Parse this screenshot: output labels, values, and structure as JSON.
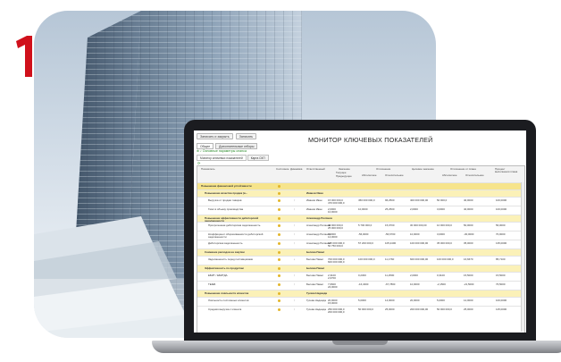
{
  "brand": {
    "logo_text": "1С",
    "registered_mark": "®",
    "red": "#d0101b"
  },
  "window": {
    "title": "МОНИТОР КЛЮЧЕВЫХ ПОКАЗАТЕЛЕЙ",
    "toolbar": [
      {
        "label": "Записать и закрыть"
      },
      {
        "label": "Записать"
      }
    ],
    "tabs": [
      {
        "label": "Общее"
      },
      {
        "label": "Дополнительные отборы"
      }
    ],
    "settings_link": "⊕ ♪ Основные параметры сеанса",
    "subtabs": [
      {
        "label": "Монитор ключевых показателей"
      },
      {
        "label": "Карта СКП"
      }
    ],
    "refresh_icon": "refresh-icon"
  },
  "table": {
    "headers": {
      "indicator": "Показатель",
      "status": "Состояние",
      "dynamics": "Динамика",
      "responsible": "Ответственный",
      "value": "Значение",
      "value_sub1": "Текущее",
      "value_sub2": "Предыдущее",
      "deviation": "Отклонение",
      "deviation_abs": "Абсолютное",
      "deviation_rel": "Относительное",
      "target": "Целевое значение",
      "target_dev": "Отклонение от плана",
      "target_dev_abs": "Абсолютное",
      "target_dev_rel": "Относительное",
      "fulfilment": "Процент выполнения плана"
    },
    "rows": [
      {
        "kind": "top",
        "name": "Повышение финансовой устойчивости",
        "status": "●",
        "dyn": "",
        "resp": "",
        "cur": "",
        "prev": "",
        "abs": "",
        "rel": "",
        "target": "",
        "tabs": "",
        "trel": "",
        "pct": "",
        "dot": "#e3b62a"
      },
      {
        "kind": "group",
        "name": "Повышение качества продаж (в...",
        "status": "●",
        "dyn": "",
        "resp": "Иванов Иван",
        "cur": "",
        "prev": "",
        "abs": "",
        "rel": "",
        "target": "",
        "tabs": "",
        "trel": "",
        "pct": "",
        "dot": "#e3b62a"
      },
      {
        "kind": "item",
        "name": "Выручка от продаж товаров",
        "status": "●",
        "dyn": "↑",
        "resp": "Иванов Иван",
        "cur": "15 000 000,0",
        "prev": "470 000 000,0",
        "abs": "450 000 000,0",
        "rel": "96,2500",
        "target": "400 000 000,00",
        "tabs": "50 000,0",
        "trel": "40,0000",
        "pct": "100,0000",
        "dot": "#e3b62a"
      },
      {
        "kind": "item",
        "name": "Темп в объему производства",
        "status": "●",
        "dyn": "↑",
        "resp": "Иванов Иван",
        "cur": "2,0000",
        "prev": "10,0000",
        "abs": "10,0000",
        "rel": "25,2500",
        "target": "2,0000",
        "tabs": "3,0000",
        "trel": "40,0000",
        "pct": "100,0000",
        "dot": "#e3b62a"
      },
      {
        "kind": "group",
        "name": "Повышение эффективности дебиторской задолженности",
        "status": "●",
        "dyn": "",
        "resp": "Александр Полянов",
        "cur": "",
        "prev": "",
        "abs": "",
        "rel": "",
        "target": "",
        "tabs": "",
        "trel": "",
        "pct": "",
        "dot": "#e3b62a"
      },
      {
        "kind": "item",
        "name": "Просроченная дебиторская задолженность",
        "status": "●",
        "dyn": "↑",
        "resp": "Александр Полянов",
        "cur": "40 000 000,0",
        "prev": "25 000 000,0",
        "abs": "5 700 000,0",
        "rel": "15,0700",
        "target": "30 000 000,00",
        "tabs": "10 000 000,0",
        "trel": "50,0000",
        "pct": "56,0000",
        "dot": "#e3b62a"
      },
      {
        "kind": "item",
        "name": "Коэффициент оборачиваемости дебиторской задолженности",
        "status": "●",
        "dyn": "↑",
        "resp": "Александр Полянов",
        "cur": "7,0000",
        "prev": "14,0000",
        "abs": "-56,0000",
        "rel": "-56,6700",
        "target": "10,0000",
        "tabs": "3,0000",
        "trel": "-30,0000",
        "pct": "70,0000",
        "dot": "#e3b62a"
      },
      {
        "kind": "item",
        "name": "Дебиторская задолженность",
        "status": "●",
        "dyn": "↑",
        "resp": "Александр Полянов",
        "cur": "135 000 000,0",
        "prev": "50 750 000,0",
        "abs": "57 200 000,0",
        "rel": "105,2400",
        "target": "100 000 000,00",
        "tabs": "35 000 000,0",
        "trel": "35,0000",
        "pct": "135,0000",
        "dot": "#e3b62a"
      },
      {
        "kind": "group",
        "name": "Снижение расходов на закупки",
        "status": "●",
        "dyn": "",
        "resp": "Белова Павел",
        "cur": "",
        "prev": "",
        "abs": "",
        "rel": "",
        "target": "",
        "tabs": "",
        "trel": "",
        "pct": "",
        "dot": "#e3b62a"
      },
      {
        "kind": "item",
        "name": "Задолженность перед поставщиками",
        "status": "●",
        "dyn": "↓",
        "resp": "Белова Павел",
        "cur": "700 000 000,0",
        "prev": "600 000 000,0",
        "abs": "100 000 000,0",
        "rel": "11,1760",
        "target": "600 000 000,00",
        "tabs": "100 000 000,0",
        "trel": "16,6670",
        "pct": "85,7100",
        "dot": "#e3b62a"
      },
      {
        "kind": "group",
        "name": "Эффективность по продуктам",
        "status": "●",
        "dyn": "",
        "resp": "Белова Павел",
        "cur": "",
        "prev": "",
        "abs": "",
        "rel": "",
        "target": "",
        "tabs": "",
        "trel": "",
        "pct": "",
        "dot": "#e3b62a"
      },
      {
        "kind": "item",
        "name": "ЕБИТ / ЕБИТДА",
        "status": "●",
        "dyn": "↑",
        "resp": "Белова Павел",
        "cur": "2,3100",
        "prev": "2,0700",
        "abs": "0,2300",
        "rel": "11,2500",
        "target": "2,0000",
        "tabs": "0,3100",
        "trel": "15,5000",
        "pct": "15,5000",
        "dot": "#e3b62a"
      },
      {
        "kind": "item",
        "name": "ТЕ/ЕБ",
        "status": "●",
        "dyn": "↑",
        "resp": "Белова Павел",
        "cur": "7,6600",
        "prev": "24,0000",
        "abs": "-16,3400",
        "rel": "-67,7800",
        "target": "10,0000",
        "tabs": "-2,1500",
        "trel": "-21,5000",
        "pct": "76,5000",
        "dot": "#e3b62a"
      },
      {
        "kind": "group",
        "name": "Повышение лояльности клиентов",
        "status": "●",
        "dyn": "",
        "resp": "Гусева Надежда",
        "cur": "",
        "prev": "",
        "abs": "",
        "rel": "",
        "target": "",
        "tabs": "",
        "trel": "",
        "pct": "",
        "dot": "#e3b62a"
      },
      {
        "kind": "item",
        "name": "Лояльность постоянных клиентов",
        "status": "●",
        "dyn": "↑",
        "resp": "Гусева Надежда",
        "cur": "20,0000",
        "prev": "15,0000",
        "abs": "5,0000",
        "rel": "14,0000",
        "target": "20,0000",
        "tabs": "5,0000",
        "trel": "12,0000",
        "pct": "100,0000",
        "dot": "#e3b62a"
      },
      {
        "kind": "item",
        "name": "Средняя выручка с клиента",
        "status": "●",
        "dyn": "↑",
        "resp": "Гусева Надежда",
        "cur": "250 000 000,0",
        "prev": "200 000 000,0",
        "abs": "50 000 000,0",
        "rel": "25,0000",
        "target": "200 000 000,00",
        "tabs": "50 000 000,0",
        "trel": "25,0000",
        "pct": "125,0000",
        "dot": "#e3b62a"
      }
    ]
  }
}
